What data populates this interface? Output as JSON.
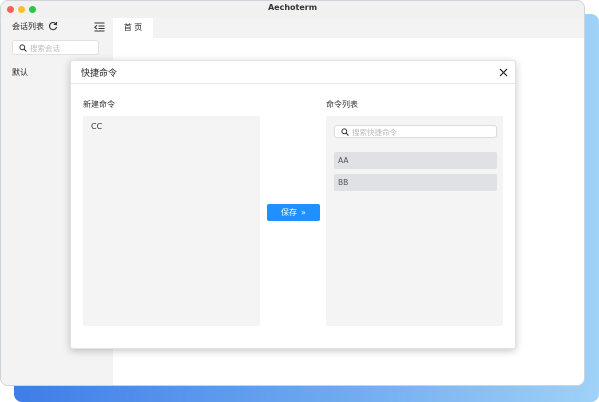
{
  "window": {
    "title": "Aechoterm"
  },
  "sidebar": {
    "header_label": "会话列表",
    "search_placeholder": "搜索会话",
    "group_label": "默认"
  },
  "tabs": [
    {
      "label": "首 页"
    }
  ],
  "modal": {
    "title": "快捷命令",
    "new_command": {
      "label": "新建命令",
      "value": "CC"
    },
    "save_button": {
      "label": "保存",
      "arrow": "»"
    },
    "command_list": {
      "label": "命令列表",
      "search_placeholder": "搜索快捷命令",
      "items": [
        {
          "label": "AA"
        },
        {
          "label": "BB"
        }
      ]
    }
  },
  "colors": {
    "accent": "#1e90ff",
    "traffic_red": "#fe5f57",
    "traffic_yellow": "#febc2e",
    "traffic_green": "#28c840"
  },
  "icons": {
    "refresh": "refresh-icon",
    "menu": "menu-collapse-icon",
    "search": "search-icon",
    "close": "close-icon"
  }
}
